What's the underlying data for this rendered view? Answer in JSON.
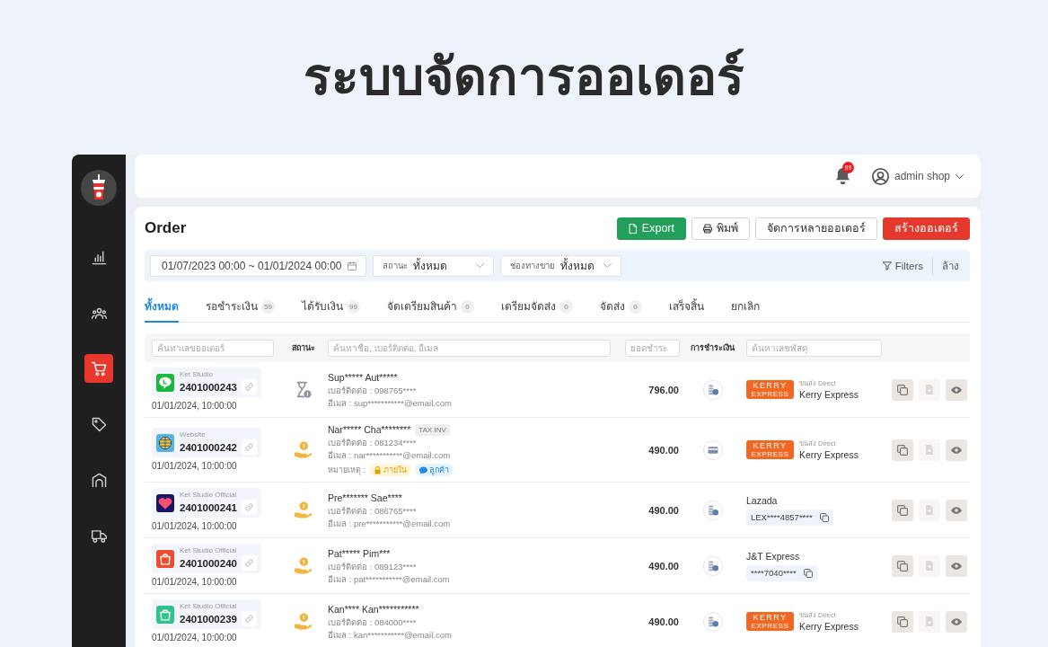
{
  "page": {
    "title": "ระบบจัดการออเดอร์"
  },
  "sidebar": {
    "items": [
      {
        "kind": "chart",
        "selected": false
      },
      {
        "kind": "users",
        "selected": false
      },
      {
        "kind": "cart",
        "selected": true
      },
      {
        "kind": "tag",
        "selected": false
      },
      {
        "kind": "store",
        "selected": false
      },
      {
        "kind": "truck",
        "selected": false
      }
    ]
  },
  "top_bar": {
    "notification_count": "99",
    "user_name": "admin shop"
  },
  "header": {
    "title": "Order",
    "buttons": [
      {
        "kind": "export",
        "label": "Export"
      },
      {
        "kind": "print",
        "label": "พิมพ์"
      },
      {
        "kind": "outline",
        "label": "จัดการหลายออเดอร์"
      },
      {
        "kind": "create",
        "label": "สร้างออเดอร์"
      }
    ]
  },
  "filters": {
    "date_range": "01/07/2023 00:00 ~ 01/01/2024 00:00",
    "selects": [
      {
        "label": "สถานะ",
        "value": "ทั้งหมด"
      },
      {
        "label": "ช่องทางขาย",
        "value": "ทั้งหมด"
      }
    ],
    "filters_button": "Filters",
    "clear_button": "ล้าง"
  },
  "tabs": [
    {
      "label": "ทั้งหมด",
      "selected": true
    },
    {
      "label": "รอชำระเงิน",
      "count": "59",
      "selected": false
    },
    {
      "label": "ได้รับเงิน",
      "count": "99",
      "selected": false
    },
    {
      "label": "จัดเตรียมสินค้า",
      "count": "0",
      "selected": false
    },
    {
      "label": "เตรียมจัดส่ง",
      "count": "0",
      "selected": false
    },
    {
      "label": "จัดส่ง",
      "count": "0",
      "selected": false
    },
    {
      "label": "เสร็จสิ้น",
      "selected": false
    },
    {
      "label": "ยกเลิก",
      "selected": false
    }
  ],
  "table": {
    "search_row": {
      "order_search": {
        "placeholder": "ค้นหาเลขออเดอร์"
      },
      "status_label": "สถานะ",
      "customer_search": {
        "placeholder": "ค้นหาชื่อ, เบอร์ติดต่อ, อีเมล"
      },
      "amount_search": {
        "placeholder": "ยอดชำระ"
      },
      "payment_label": "การชำระเงิน",
      "tracking_search": {
        "placeholder": "ค้นหาเลขพัสดุ"
      }
    },
    "rows": [
      {
        "channel": {
          "kind": "line",
          "store": "Ket Studio"
        },
        "order_no": "2401000243",
        "date": "01/01/2024, 10:00:00",
        "status": {
          "kind": "awaiting_payment"
        },
        "customer": {
          "name": "Sup***** Aut*****",
          "phone": "เบอร์ติดต่อ : 098765****",
          "email": "อีเมล : sup***********@email.com"
        },
        "amount": "796.00",
        "payment": {
          "kind": "coins"
        },
        "shipping": {
          "kind": "kerry",
          "logo": "KERRY",
          "logo_sub": "EXPRESS",
          "type": "ขนส่ง Direct",
          "name": "Kerry Express"
        },
        "actions": [
          {
            "kind": "copy",
            "disabled": false
          },
          {
            "kind": "invoice",
            "disabled": true
          },
          {
            "kind": "view",
            "disabled": false
          }
        ]
      },
      {
        "channel": {
          "kind": "website",
          "store": "Website"
        },
        "order_no": "2401000242",
        "date": "01/01/2024, 10:00:00",
        "status": {
          "kind": "paid"
        },
        "customer": {
          "name": "Nar***** Cha********",
          "badge": "TAX INV",
          "phone": "เบอร์ติดต่อ : 081234****",
          "email": "อีเมล : nar***********@email.com",
          "note": {
            "label": "หมายเหตุ :",
            "tags": [
              {
                "kind": "internal",
                "label": "ภายใน"
              },
              {
                "kind": "customer",
                "label": "ลูกค้า"
              }
            ]
          }
        },
        "amount": "490.00",
        "payment": {
          "kind": "card"
        },
        "shipping": {
          "kind": "kerry",
          "logo": "KERRY",
          "logo_sub": "EXPRESS",
          "type": "ขนส่ง Direct",
          "name": "Kerry Express"
        },
        "actions": [
          {
            "kind": "copy",
            "disabled": false
          },
          {
            "kind": "invoice",
            "disabled": true
          },
          {
            "kind": "view",
            "disabled": false
          }
        ]
      },
      {
        "channel": {
          "kind": "lazada",
          "store": "Ket Studio Official"
        },
        "order_no": "2401000241",
        "date": "01/01/2024, 10:00:00",
        "status": {
          "kind": "paid"
        },
        "customer": {
          "name": "Pre******* Sae****",
          "phone": "เบอร์ติดต่อ : 086765****",
          "email": "อีเมล : pre***********@email.com"
        },
        "amount": "490.00",
        "payment": {
          "kind": "coins"
        },
        "shipping": {
          "kind": "tracking",
          "carrier": "Lazada",
          "tracking_no": "LEX****4857****"
        },
        "actions": [
          {
            "kind": "copy",
            "disabled": false
          },
          {
            "kind": "invoice",
            "disabled": true
          },
          {
            "kind": "view",
            "disabled": false
          }
        ]
      },
      {
        "channel": {
          "kind": "shopee",
          "store": "Ket Studio Official"
        },
        "order_no": "2401000240",
        "date": "01/01/2024, 10:00:00",
        "status": {
          "kind": "paid"
        },
        "customer": {
          "name": "Pat***** Pim***",
          "phone": "เบอร์ติดต่อ : 089123****",
          "email": "อีเมล : pat***********@email.com"
        },
        "amount": "490.00",
        "payment": {
          "kind": "coins"
        },
        "shipping": {
          "kind": "tracking",
          "carrier": "J&T Express",
          "tracking_no": "****7040****"
        },
        "actions": [
          {
            "kind": "copy",
            "disabled": false
          },
          {
            "kind": "invoice",
            "disabled": true
          },
          {
            "kind": "view",
            "disabled": false
          }
        ]
      },
      {
        "channel": {
          "kind": "bag",
          "store": "Ket Studio Official"
        },
        "order_no": "2401000239",
        "date": "01/01/2024, 10:00:00",
        "status": {
          "kind": "paid"
        },
        "customer": {
          "name": "Kan**** Kan***********",
          "phone": "เบอร์ติดต่อ : 084000****",
          "email": "อีเมล : kan***********@email.com"
        },
        "amount": "490.00",
        "payment": {
          "kind": "coins"
        },
        "shipping": {
          "kind": "kerry",
          "logo": "KERRY",
          "logo_sub": "EXPRESS",
          "type": "ขนส่ง Direct",
          "name": "Kerry Express"
        },
        "actions": [
          {
            "kind": "copy",
            "disabled": false
          },
          {
            "kind": "invoice",
            "disabled": true
          },
          {
            "kind": "view",
            "disabled": false
          }
        ]
      }
    ]
  }
}
